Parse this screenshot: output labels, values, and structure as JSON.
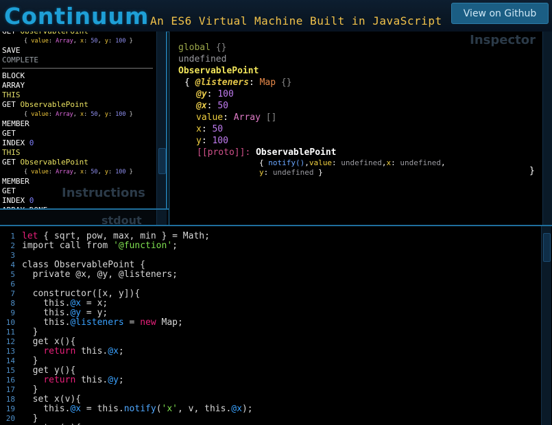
{
  "header": {
    "logo": "Continuum",
    "tagline": "An ES6 Virtual Machine Built in JavaScript",
    "github_button": "View on Github"
  },
  "instructions": {
    "title": "Instructions",
    "items": [
      {
        "op": "GET",
        "arg": "ObservablePoint"
      },
      {
        "sub": true
      },
      {
        "op": "SAVE"
      },
      {
        "op": "COMPLETE",
        "dim": true
      },
      {
        "divider": true
      },
      {
        "op": "BLOCK"
      },
      {
        "op": "ARRAY"
      },
      {
        "op": "THIS",
        "this": true
      },
      {
        "op": "GET",
        "arg": "ObservablePoint"
      },
      {
        "sub": true
      },
      {
        "op": "MEMBER"
      },
      {
        "op": "GET"
      },
      {
        "op": "INDEX",
        "num": "0"
      },
      {
        "op": "THIS",
        "this": true
      },
      {
        "op": "GET",
        "arg": "ObservablePoint"
      },
      {
        "sub": true
      },
      {
        "op": "MEMBER"
      },
      {
        "op": "GET"
      },
      {
        "op": "INDEX",
        "num": "0"
      },
      {
        "op": "ARRAY_DONE"
      }
    ],
    "sub_value": {
      "k1": "value",
      "v1": "Array",
      "k2": "x",
      "v2": "50",
      "k3": "y",
      "v3": "100"
    }
  },
  "stdout": {
    "title": "stdout"
  },
  "inspector": {
    "title": "Inspector",
    "global_label": "global",
    "global_braces": "{}",
    "undefined_label": "undefined",
    "object_label": "ObservablePoint",
    "open_brace": "{",
    "listeners_key": "@listeners",
    "listeners_type": "Map",
    "listeners_val": "{}",
    "props": [
      {
        "key": "@y",
        "val": "100",
        "kind": "private"
      },
      {
        "key": "@x",
        "val": "50",
        "kind": "private"
      },
      {
        "key": "value",
        "val": "Array",
        "kind": "array",
        "extra": "[]"
      },
      {
        "key": "x",
        "val": "50",
        "kind": "plain"
      },
      {
        "key": "y",
        "val": "100",
        "kind": "plain"
      }
    ],
    "proto_key": "[[proto]]:",
    "proto_val": "ObservablePoint",
    "proto_line1": {
      "fn": "notify()",
      "k1": "value",
      "v1": "undefined",
      "k2": "x",
      "v2": "undefined"
    },
    "proto_line2": {
      "k": "y",
      "v": "undefined",
      "close": "}"
    },
    "close_brace": "}"
  },
  "editor": {
    "line_numbers": [
      "1",
      "2",
      "3",
      "4",
      "5",
      "6",
      "7",
      "8",
      "9",
      "10",
      "11",
      "12",
      "13",
      "14",
      "15",
      "16",
      "17",
      "18",
      "19",
      "20"
    ]
  }
}
